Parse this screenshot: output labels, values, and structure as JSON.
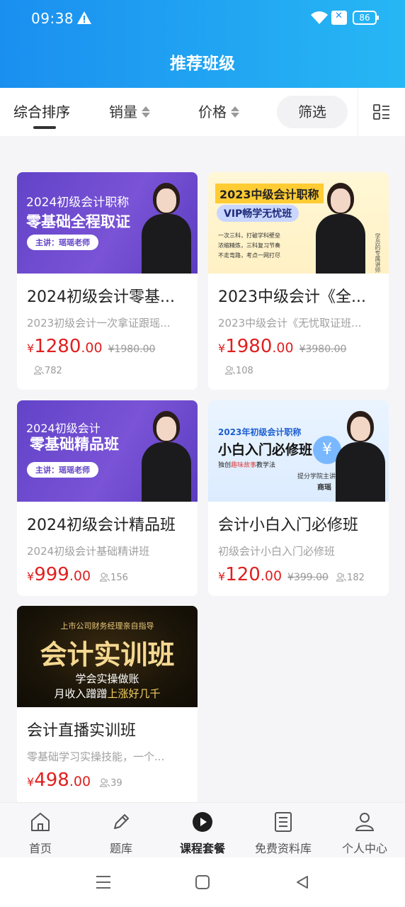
{
  "status": {
    "time": "09:38",
    "battery": "86"
  },
  "header": {
    "title": "推荐班级"
  },
  "sort": {
    "items": [
      {
        "label": "综合排序"
      },
      {
        "label": "销量"
      },
      {
        "label": "价格"
      }
    ],
    "filter_label": "筛选"
  },
  "courses": [
    {
      "banner_line1": "2024初级会计职称",
      "banner_line2": "零基础全程取证",
      "banner_tag": "主讲：瑶瑶老师",
      "title": "2024初级会计零基...",
      "subtitle": "2023初级会计一次拿证跟瑶...",
      "price_int": "1280",
      "price_dec": ".00",
      "price_yen": "¥",
      "old_price": "¥1980.00",
      "students": "782"
    },
    {
      "banner_line1": "2023中级会计职称",
      "banner_line2": "VIP畅学无忧班",
      "banner_bullets": [
        "一次三科，打破学科壁垒",
        "浓缩精炼，三科复习节奏",
        "不走弯路，考点一网打尽"
      ],
      "banner_side": "学员的专属讲师",
      "title": "2023中级会计《全...",
      "subtitle": "2023中级会计《无忧取证班...",
      "price_int": "1980",
      "price_dec": ".00",
      "price_yen": "¥",
      "old_price": "¥3980.00",
      "students": "108"
    },
    {
      "banner_line1": "2024初级会计",
      "banner_line2": "零基础精品班",
      "banner_tag": "主讲：瑶瑶老师",
      "title": "2024初级会计精品班",
      "subtitle": "2024初级会计基础精讲班",
      "price_int": "999",
      "price_dec": ".00",
      "price_yen": "¥",
      "students": "156"
    },
    {
      "banner_line1": "2023年初级会计职称",
      "banner_line2": "小白入门必修班",
      "banner_line3_a": "独创",
      "banner_line3_b": "趣味故事",
      "banner_line3_c": "教学法",
      "banner_teacher_a": "提分学院主讲老师",
      "banner_teacher_b": "商瑶",
      "title": "会计小白入门必修班",
      "subtitle": "初级会计小白入门必修班",
      "price_int": "120",
      "price_dec": ".00",
      "price_yen": "¥",
      "old_price": "¥399.00",
      "students": "182"
    },
    {
      "banner_line1": "上市公司财务经理亲自指导",
      "banner_line2": "会计实训班",
      "banner_line3": "学会实操做账",
      "banner_line4_a": "月收入蹭蹭",
      "banner_line4_b": "上涨好几千",
      "title": "会计直播实训班",
      "subtitle": "零基础学习实操技能，一个...",
      "price_int": "498",
      "price_dec": ".00",
      "price_yen": "¥",
      "students": "39"
    }
  ],
  "tabs": [
    {
      "label": "首页",
      "icon": "home-icon"
    },
    {
      "label": "题库",
      "icon": "pencil-icon"
    },
    {
      "label": "课程套餐",
      "icon": "play-icon"
    },
    {
      "label": "免费资料库",
      "icon": "document-icon"
    },
    {
      "label": "个人中心",
      "icon": "person-icon"
    }
  ],
  "colors": {
    "accent": "#1a8ff0",
    "price": "#e02020",
    "purple": "#6243c8"
  }
}
